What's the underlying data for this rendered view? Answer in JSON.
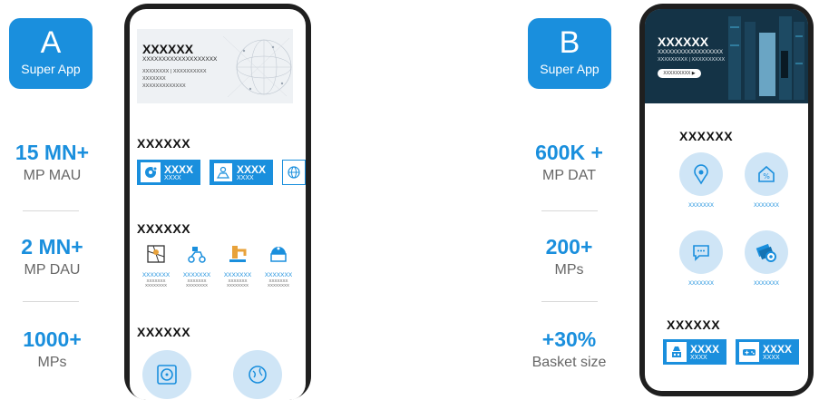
{
  "left": {
    "badge": {
      "letter": "A",
      "label": "Super App"
    },
    "stats": [
      {
        "value": "15 MN+",
        "label": "MP MAU"
      },
      {
        "value": "2 MN+",
        "label": "MP DAU"
      },
      {
        "value": "1000+",
        "label": "MPs"
      }
    ],
    "phone": {
      "banner": {
        "title": "XXXXXX",
        "subtitle": "XXXXXXXXXXXXXXXXXXX",
        "lines": [
          "XXXXXXXX | XXXXXXXXXX",
          "XXXXXXX",
          "XXXXXXXXXXXXX"
        ]
      },
      "section1": {
        "title": "XXXXXX",
        "tiles": [
          {
            "title": "XXXX",
            "sub": "XXXX"
          },
          {
            "title": "XXXX",
            "sub": "XXXX"
          }
        ]
      },
      "section2": {
        "title": "XXXXXX",
        "services": [
          {
            "label": "XXXXXXX",
            "line1": "XXXXXXX",
            "line2": "XXXXXXXX"
          },
          {
            "label": "XXXXXXX",
            "line1": "XXXXXXX",
            "line2": "XXXXXXXX"
          },
          {
            "label": "XXXXXXX",
            "line1": "XXXXXXX",
            "line2": "XXXXXXXX"
          },
          {
            "label": "XXXXXXX",
            "line1": "XXXXXXX",
            "line2": "XXXXXXXX"
          }
        ]
      },
      "section3": {
        "title": "XXXXXX"
      }
    }
  },
  "right": {
    "badge": {
      "letter": "B",
      "label": "Super App"
    },
    "stats": [
      {
        "value": "600K +",
        "label": "MP DAT"
      },
      {
        "value": "200+",
        "label": "MPs"
      },
      {
        "value": "+30%",
        "label": "Basket size"
      }
    ],
    "phone": {
      "banner": {
        "title": "XXXXXX",
        "subtitle": "XXXXXXXXXXXXXXXXXX",
        "line": "XXXXXXXXX | XXXXXXXXXX",
        "button": "XXXXXXXXX ▶"
      },
      "section1": {
        "title": "XXXXXX",
        "items": [
          "XXXXXXX",
          "XXXXXXX",
          "XXXXXXX",
          "XXXXXXX"
        ]
      },
      "section2": {
        "title": "XXXXXX",
        "tiles": [
          {
            "title": "XXXX",
            "sub": "XXXX"
          },
          {
            "title": "XXXX",
            "sub": "XXXX"
          }
        ]
      }
    }
  },
  "colors": {
    "accent": "#1a8fdd",
    "circle": "#cfe5f6",
    "phone": "#1f1f1f"
  }
}
